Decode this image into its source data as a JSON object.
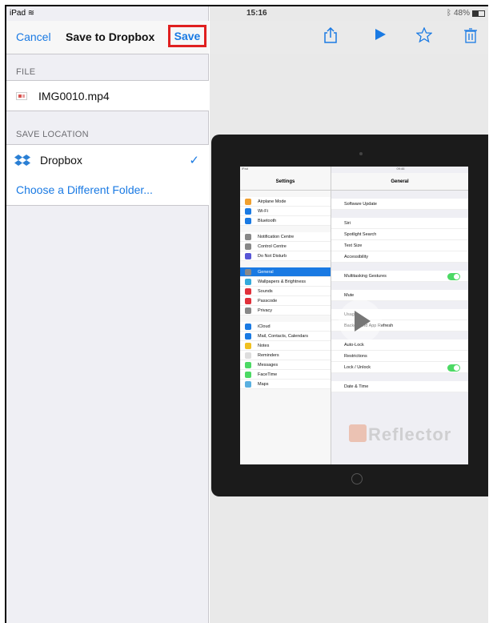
{
  "status_bar": {
    "device": "iPad",
    "wifi_icon": "wifi-icon",
    "time": "15:16",
    "bluetooth_icon": "bluetooth-icon",
    "battery": "48%"
  },
  "nav": {
    "cancel": "Cancel",
    "title": "Save to Dropbox",
    "save": "Save"
  },
  "file_section": {
    "header": "FILE",
    "file_name": "IMG0010.mp4",
    "icon": "video-file-icon"
  },
  "location_section": {
    "header": "SAVE LOCATION",
    "selected": "Dropbox",
    "check": "✓",
    "choose_folder": "Choose a Different Folder..."
  },
  "toolbar": {
    "share_icon": "share-icon",
    "play_icon": "play-icon",
    "star_icon": "star-icon",
    "trash_icon": "trash-icon"
  },
  "preview": {
    "screen_status": {
      "left": "iPad",
      "time": "09:46",
      "right": "35%"
    },
    "settings_title": "Settings",
    "general_title": "General",
    "left_groups": [
      [
        {
          "label": "Airplane Mode",
          "color": "#f0a030"
        },
        {
          "label": "Wi-Fi",
          "color": "#1a7ae3"
        },
        {
          "label": "Bluetooth",
          "color": "#1a7ae3"
        }
      ],
      [
        {
          "label": "Notification Centre",
          "color": "#888"
        },
        {
          "label": "Control Centre",
          "color": "#888"
        },
        {
          "label": "Do Not Disturb",
          "color": "#5856d6"
        }
      ],
      [
        {
          "label": "General",
          "color": "#888",
          "selected": true
        },
        {
          "label": "Wallpapers & Brightness",
          "color": "#34aadc"
        },
        {
          "label": "Sounds",
          "color": "#e0303a"
        },
        {
          "label": "Passcode",
          "color": "#e0303a"
        },
        {
          "label": "Privacy",
          "color": "#888"
        }
      ],
      [
        {
          "label": "iCloud",
          "color": "#1a7ae3"
        },
        {
          "label": "Mail, Contacts, Calendars",
          "color": "#1a7ae3"
        },
        {
          "label": "Notes",
          "color": "#f0c020"
        },
        {
          "label": "Reminders",
          "color": "#ddd"
        },
        {
          "label": "Messages",
          "color": "#4cd964"
        },
        {
          "label": "FaceTime",
          "color": "#4cd964"
        },
        {
          "label": "Maps",
          "color": "#5ab0e0"
        }
      ]
    ],
    "right_groups": [
      [
        "Software Update"
      ],
      [
        "Siri",
        "Spotlight Search",
        "Text Size",
        "Accessibility"
      ],
      [
        "Multitasking Gestures"
      ],
      [
        "Mute"
      ],
      [
        "Usage",
        "Background App Refresh"
      ],
      [
        "Auto-Lock",
        "Restrictions",
        "Lock / Unlock"
      ],
      [
        "Date & Time"
      ]
    ],
    "watermark": "Reflector"
  }
}
